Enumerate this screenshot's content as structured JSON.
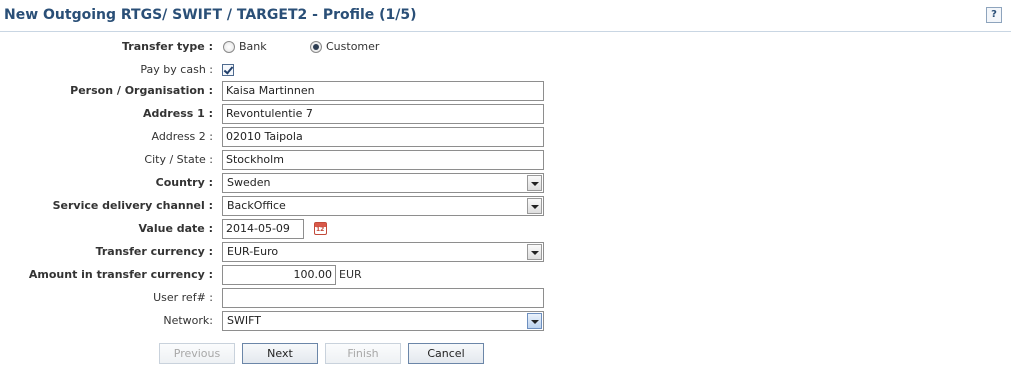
{
  "header": {
    "title": "New Outgoing RTGS/ SWIFT / TARGET2 - Profile (1/5)",
    "help_label": "?"
  },
  "form": {
    "transfer_type": {
      "label": "Transfer type :",
      "options": [
        "Bank",
        "Customer"
      ],
      "selected": "Customer"
    },
    "pay_by_cash": {
      "label": "Pay by cash :",
      "checked": true
    },
    "person": {
      "label": "Person / Organisation :",
      "value": "Kaisa Martinnen"
    },
    "address1": {
      "label": "Address 1 :",
      "value": "Revontulentie 7"
    },
    "address2": {
      "label": "Address 2 :",
      "value": "02010 Taipola"
    },
    "city": {
      "label": "City / State :",
      "value": "Stockholm"
    },
    "country": {
      "label": "Country :",
      "value": "Sweden"
    },
    "channel": {
      "label": "Service delivery channel :",
      "value": "BackOffice"
    },
    "value_date": {
      "label": "Value date :",
      "value": "2014-05-09"
    },
    "currency": {
      "label": "Transfer currency :",
      "value": "EUR-Euro"
    },
    "amount": {
      "label": "Amount in transfer currency :",
      "value": "100.00",
      "unit": "EUR"
    },
    "user_ref": {
      "label": "User ref# :",
      "value": ""
    },
    "network": {
      "label": "Network:",
      "value": "SWIFT"
    }
  },
  "buttons": {
    "previous": "Previous",
    "next": "Next",
    "finish": "Finish",
    "cancel": "Cancel"
  },
  "icons": {
    "calendar": "calendar-icon",
    "help": "help-icon",
    "dropdown": "chevron-down-icon"
  }
}
